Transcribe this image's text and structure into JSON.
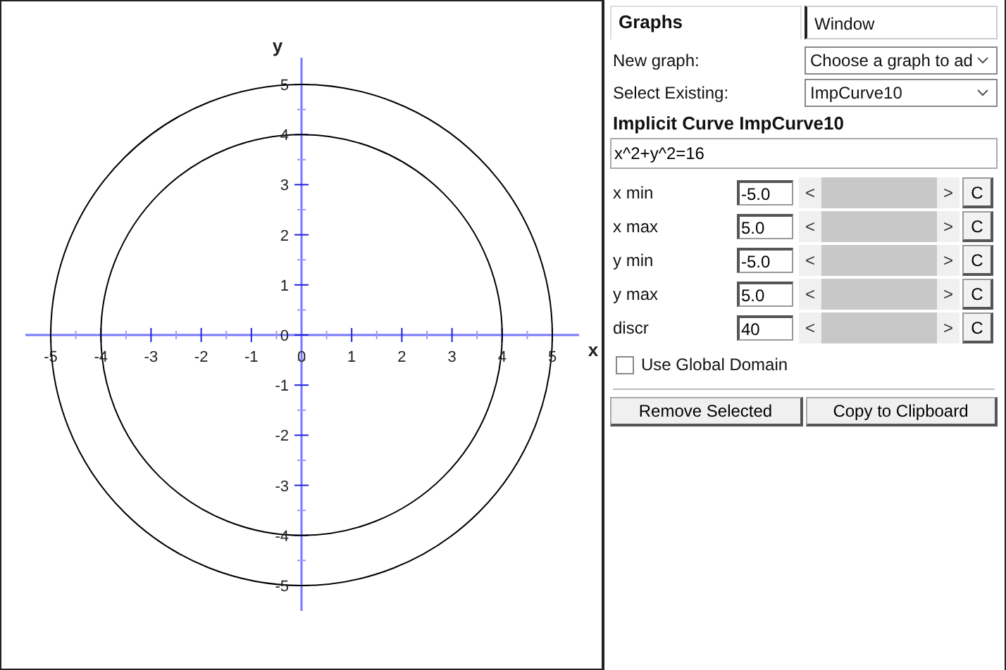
{
  "graph": {
    "x_axis_label": "x",
    "y_axis_label": "y",
    "x_tick_labels": [
      "-5",
      "-4",
      "-3",
      "-2",
      "-1",
      "0",
      "1",
      "2",
      "3",
      "4",
      "5"
    ],
    "y_tick_labels": [
      "5",
      "4",
      "3",
      "2",
      "1",
      "0",
      "-1",
      "-2",
      "-3",
      "-4",
      "-5"
    ]
  },
  "tabs": [
    {
      "label": "Graphs",
      "selected": true
    },
    {
      "label": "Window",
      "selected": false
    }
  ],
  "new_graph": {
    "label": "New graph:",
    "value": "Choose a graph to ad"
  },
  "select_existing": {
    "label": "Select Existing:",
    "value": "ImpCurve10"
  },
  "heading": "Implicit Curve ImpCurve10",
  "equation": "x^2+y^2=16",
  "params": [
    {
      "label": "x min",
      "value": "-5.0",
      "left": "<",
      "right": ">",
      "reset": "C"
    },
    {
      "label": "x max",
      "value": "5.0",
      "left": "<",
      "right": ">",
      "reset": "C"
    },
    {
      "label": "y min",
      "value": "-5.0",
      "left": "<",
      "right": ">",
      "reset": "C"
    },
    {
      "label": "y max",
      "value": "5.0",
      "left": "<",
      "right": ">",
      "reset": "C"
    },
    {
      "label": "discr",
      "value": "40",
      "left": "<",
      "right": ">",
      "reset": "C"
    }
  ],
  "global_domain": {
    "label": "Use Global Domain",
    "checked": false
  },
  "buttons": [
    "Remove Selected",
    "Copy to Clipboard"
  ]
}
